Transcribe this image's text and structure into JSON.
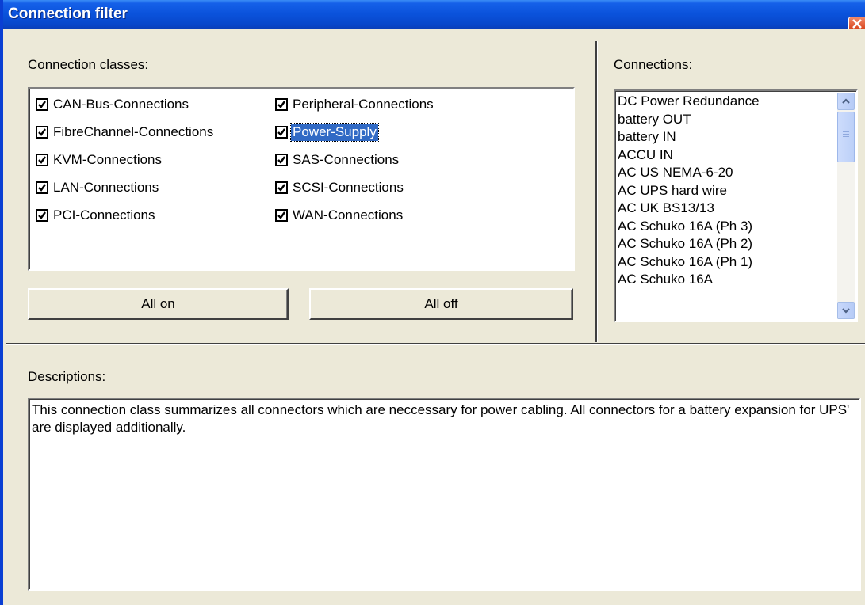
{
  "window": {
    "title": "Connection filter",
    "accent_color": "#0a52db",
    "close_icon": "close-icon"
  },
  "classes": {
    "label": "Connection classes:",
    "items": [
      {
        "label": "CAN-Bus-Connections",
        "checked": true
      },
      {
        "label": "FibreChannel-Connections",
        "checked": true
      },
      {
        "label": "KVM-Connections",
        "checked": true
      },
      {
        "label": "LAN-Connections",
        "checked": true
      },
      {
        "label": "PCI-Connections",
        "checked": true
      },
      {
        "label": "Peripheral-Connections",
        "checked": true
      },
      {
        "label": "Power-Supply",
        "checked": true,
        "selected": true
      },
      {
        "label": "SAS-Connections",
        "checked": true
      },
      {
        "label": "SCSI-Connections",
        "checked": true
      },
      {
        "label": "WAN-Connections",
        "checked": true
      }
    ],
    "all_on_label": "All on",
    "all_off_label": "All off"
  },
  "connections": {
    "label": "Connections:",
    "items": [
      "DC Power Redundance",
      "battery OUT",
      "battery IN",
      "ACCU IN",
      "AC US NEMA-6-20",
      "AC UPS hard wire",
      "AC UK BS13/13",
      "AC Schuko 16A (Ph 3)",
      "AC Schuko 16A (Ph 2)",
      "AC Schuko 16A (Ph 1)",
      "AC Schuko 16A"
    ]
  },
  "descriptions": {
    "label": "Descriptions:",
    "text": "This connection class summarizes all connectors which are neccessary for power cabling. All connectors for a battery expansion for UPS' are displayed additionally."
  }
}
